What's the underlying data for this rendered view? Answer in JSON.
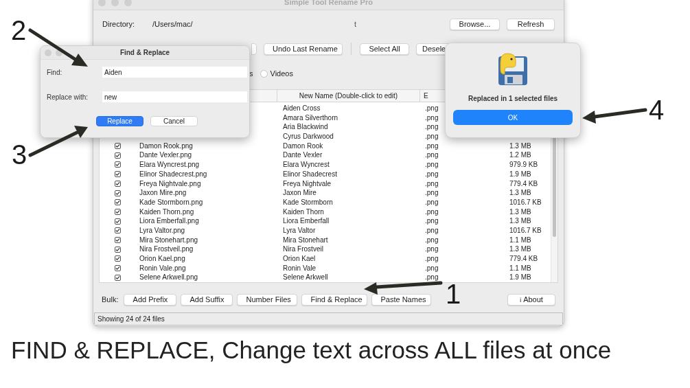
{
  "window": {
    "title": "Simple Tool Rename Pro"
  },
  "directory": {
    "label": "Directory:",
    "value": "/Users/mac/",
    "value_tail": "t"
  },
  "top_buttons": [
    "Browse...",
    "Refresh"
  ],
  "toolbar": [
    "Undo Last Rename",
    "Select All",
    "Desele"
  ],
  "filter": {
    "label_tail": "s",
    "options": [
      {
        "label": "Videos",
        "selected": false
      }
    ]
  },
  "table": {
    "columns": {
      "new_name": "New Name (Double-click to edit)",
      "extension": "E"
    },
    "rows": [
      {
        "new_name": "Aiden Cross",
        "extension": ".png"
      },
      {
        "new_name": "Amara Silverthorn",
        "extension": ".png"
      },
      {
        "new_name": "Aria Blackwind",
        "extension": ".png"
      },
      {
        "new_name": "Cyrus Darkwood",
        "extension": ".png"
      },
      {
        "checked": true,
        "old_name": "Damon Rook.png",
        "new_name": "Damon Rook",
        "extension": ".png",
        "size": "1.3 MB"
      },
      {
        "checked": true,
        "old_name": "Dante Vexler.png",
        "new_name": "Dante Vexler",
        "extension": ".png",
        "size": "1.2 MB"
      },
      {
        "checked": true,
        "old_name": "Elara Wyncrest.png",
        "new_name": "Elara Wyncrest",
        "extension": ".png",
        "size": "979.9 KB"
      },
      {
        "checked": true,
        "old_name": "Elinor Shadecrest.png",
        "new_name": "Elinor Shadecrest",
        "extension": ".png",
        "size": "1.9 MB"
      },
      {
        "checked": true,
        "old_name": "Freya Nightvale.png",
        "new_name": "Freya Nightvale",
        "extension": ".png",
        "size": "779.4 KB"
      },
      {
        "checked": true,
        "old_name": "Jaxon Mire.png",
        "new_name": "Jaxon Mire",
        "extension": ".png",
        "size": "1.3 MB"
      },
      {
        "checked": true,
        "old_name": "Kade Stormborn.png",
        "new_name": "Kade Stormborn",
        "extension": ".png",
        "size": "1016.7 KB"
      },
      {
        "checked": true,
        "old_name": "Kaiden Thorn.png",
        "new_name": "Kaiden Thorn",
        "extension": ".png",
        "size": "1.3 MB"
      },
      {
        "checked": true,
        "old_name": "Liora Emberfall.png",
        "new_name": "Liora Emberfall",
        "extension": ".png",
        "size": "1.3 MB"
      },
      {
        "checked": true,
        "old_name": "Lyra Valtor.png",
        "new_name": "Lyra Valtor",
        "extension": ".png",
        "size": "1016.7 KB"
      },
      {
        "checked": true,
        "old_name": "Mira Stonehart.png",
        "new_name": "Mira Stonehart",
        "extension": ".png",
        "size": "1.1 MB"
      },
      {
        "checked": true,
        "old_name": "Nira Frostveil.png",
        "new_name": "Nira Frostveil",
        "extension": ".png",
        "size": "1.3 MB"
      },
      {
        "checked": true,
        "old_name": "Orion Kael.png",
        "new_name": "Orion Kael",
        "extension": ".png",
        "size": "779.4 KB"
      },
      {
        "checked": true,
        "old_name": "Ronin Vale.png",
        "new_name": "Ronin Vale",
        "extension": ".png",
        "size": "1.1 MB"
      },
      {
        "checked": true,
        "old_name": "Selene Arkwell.png",
        "new_name": "Selene Arkwell",
        "extension": ".png",
        "size": "1.9 MB"
      }
    ]
  },
  "bulk": {
    "label": "Bulk:",
    "buttons": [
      "Add Prefix",
      "Add Suffix",
      "Number Files",
      "Find & Replace",
      "Paste Names"
    ],
    "about": {
      "icon": "ℹ",
      "label": "About"
    }
  },
  "status_bar": "Showing 24 of 24 files",
  "find_dialog": {
    "title": "Find & Replace",
    "fields": [
      {
        "label": "Find:",
        "value": "Aiden"
      },
      {
        "label": "Replace with:",
        "value": "new"
      }
    ],
    "buttons": [
      {
        "label": "Replace",
        "kind": "primary"
      },
      {
        "label": "Cancel",
        "kind": "secondary"
      }
    ]
  },
  "alert": {
    "message": "Replaced in 1 selected files",
    "button": "OK"
  },
  "annotations": [
    {
      "number": "2"
    },
    {
      "number": "3"
    },
    {
      "number": "4"
    },
    {
      "number": "1"
    }
  ],
  "caption": "FIND & REPLACE, Change text across ALL files at once"
}
